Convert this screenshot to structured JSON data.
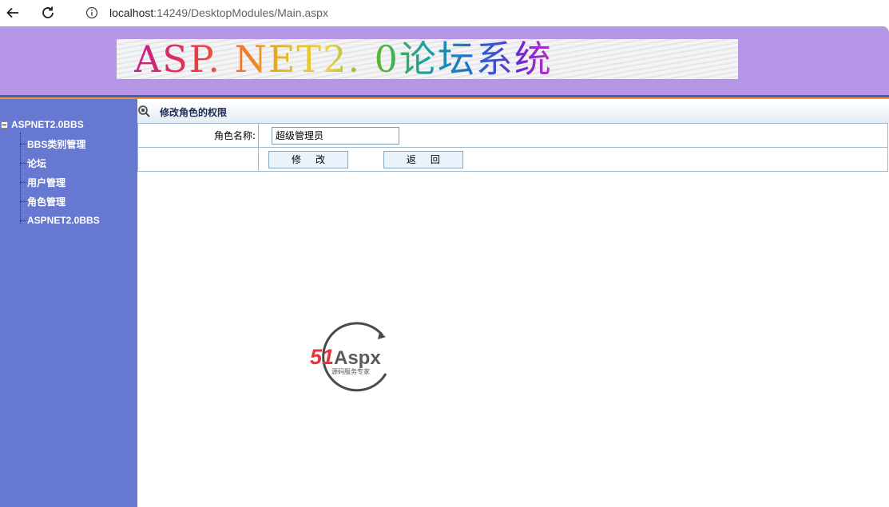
{
  "browser": {
    "url_host": "localhost",
    "url_rest": ":14249/DesktopModules/Main.aspx",
    "icons": {
      "back": "arrow-left-icon",
      "reload": "reload-icon",
      "info": "info-icon"
    }
  },
  "header": {
    "banner_text": "ASP. NET2. 0论坛系统"
  },
  "sidebar": {
    "root_label": "ASPNET2.0BBS",
    "items": [
      {
        "label": "BBS类别管理"
      },
      {
        "label": "论坛"
      },
      {
        "label": "用户管理"
      },
      {
        "label": "角色管理"
      },
      {
        "label": "ASPNET2.0BBS"
      }
    ]
  },
  "content": {
    "title": "修改角色的权限",
    "form": {
      "role_name_label": "角色名称:",
      "role_name_value": "超级管理员"
    },
    "buttons": {
      "edit": "修改",
      "back": "返回"
    }
  },
  "watermark": {
    "brand_51": "51",
    "brand_aspx": "Aspx",
    "tagline": "源码服务专家"
  },
  "colors": {
    "header_bg": "#b595e5",
    "sidebar_bg": "#6678cf",
    "title_text": "#1e2c55",
    "brand_red": "#e8333a",
    "brand_green": "#4bb54a"
  }
}
